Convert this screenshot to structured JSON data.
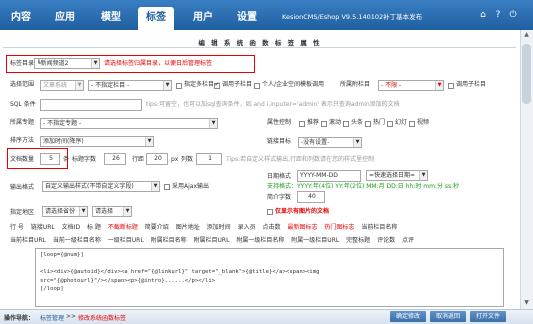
{
  "nav": {
    "tabs": [
      "内容",
      "应用",
      "模型",
      "标签",
      "用户",
      "设置"
    ],
    "brand": "KesionCMS/Eshop V9.5.140102补丁基本发布"
  },
  "page": {
    "title": "编 辑 系 统 函 数 标 签 属 性"
  },
  "form": {
    "tag_dir_label": "标签目录",
    "tag_dir_value": "┗新闻频道2",
    "tag_dir_hint": "请选择标签归属目录，以便日后管理标签",
    "channel_label": "选择范围",
    "channel_value": "文章系统",
    "column_value": "- 不指定栏目 -",
    "opt_specified_column": "指定多栏目",
    "opt_sub_columns": "调用子栏目",
    "opt_personal_channel": "个人/企业空间模板调用",
    "belong_column_label": "所属附栏目",
    "belong_column_value": "- 不限 -",
    "opt_call_sub": "调用子栏目",
    "sql_label": "SQL 条件",
    "sql_tips": "tips:可留空，也可以加sql查询条件，如 and i.inputer='admin' 表示只查询admin添加的文档",
    "special_label": "所属专题",
    "special_value": "- 不指定专题 -",
    "attr_label": "属性控制",
    "attr_items": [
      "推荐",
      "滚动",
      "头条",
      "热门",
      "幻灯",
      "视频"
    ],
    "sort_label": "排序方法",
    "sort_value": "添加时间(降序)",
    "link_label": "链接目标",
    "link_value": "-没有设置-",
    "count_label": "文档数量",
    "count_value": "5",
    "count_unit": "条",
    "title_len_label": "标题字数",
    "title_len_value": "26",
    "row_space_label": "行距",
    "row_space_value": "20",
    "row_space_unit": "px",
    "cols_label": "列数",
    "cols_value": "1",
    "cols_tips": "Tips:若自定义样式输出,行距和列数请在您的样式里控制",
    "date_label": "日期格式",
    "date_value": "YYYY-MM-DD",
    "date_select": "快速选择日期",
    "date_support": "支持格式：YYYY:年(4位) YY:年(2位) MM:月 DD:日 hh:时 mm:分 ss:秒",
    "intro_len_label": "简介字数",
    "intro_len_value": "40",
    "output_label": "输出格式",
    "output_value": "自定义输出样式(不带自定义字段)",
    "opt_ajax": "采用Ajax输出",
    "region_label": "指定地区",
    "province_value": "请选择省份",
    "city_value": "请选择",
    "opt_images_only": "仅显示有图片的文档"
  },
  "tag_rows": [
    [
      "行 号",
      "链接URL",
      "文档ID",
      "标 题",
      "不截断标题",
      "简要介绍",
      "图片地址",
      "添加时间",
      "录入员",
      "点击数",
      "最新图标志",
      "热门图标志",
      "当前栏目名称"
    ],
    [
      "当前栏目URL",
      "当前一级栏目名称",
      "一级栏目URL",
      "附属栏目名称",
      "附属栏目URL",
      "附属一级栏目名称",
      "附属一级栏目URL",
      "完整标题",
      "评论数",
      "点评"
    ]
  ],
  "template_text": "[loop={@num}]\n\n<li><div>{@autoid}</div><a href=\"{@linkurl}\" target=\"_blank\">{@title}</a><span><img\nsrc=\"{@photourl}\"/></span><p>{@intro}......</p></li>\n[/loop]",
  "footer": {
    "nav_label": "操作导航：",
    "crumb_1": "标签管理",
    "crumb_sep": ">>",
    "crumb_2": "修改系统函数标签",
    "buttons": [
      "确定修改",
      "取消返回",
      "打开文件"
    ]
  }
}
